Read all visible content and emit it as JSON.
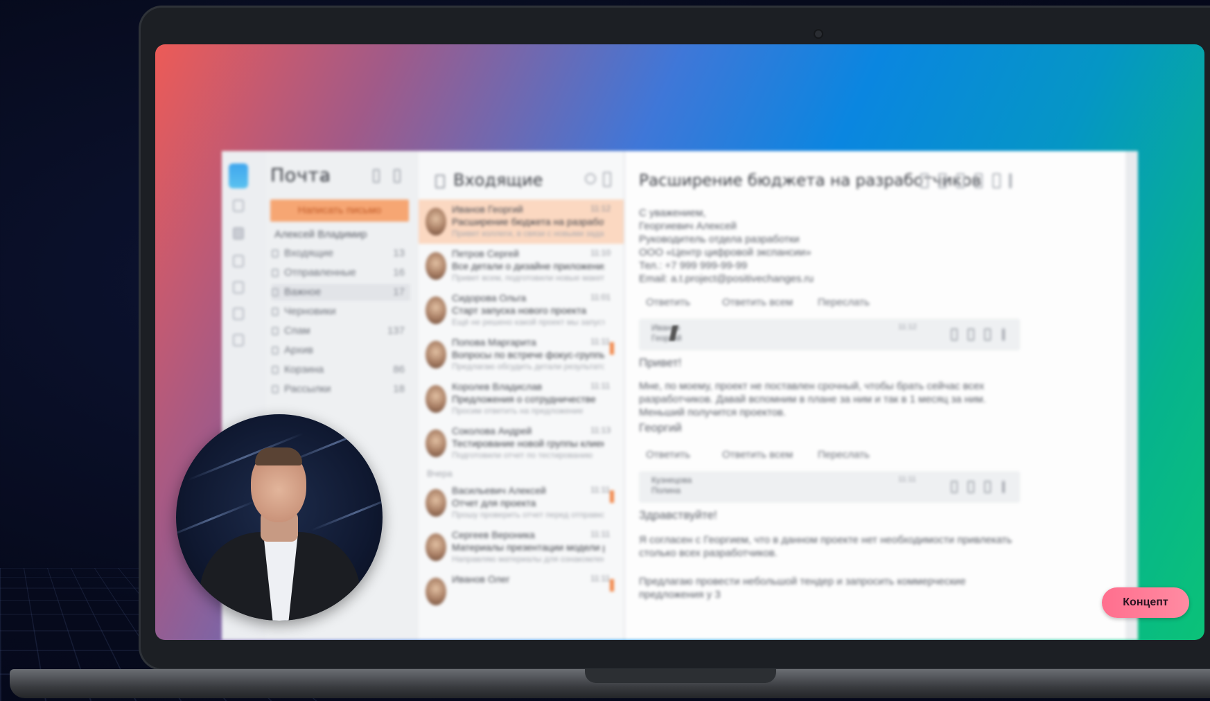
{
  "app": {
    "folders_title": "Почта",
    "write_button": "Написать письмо",
    "account": "Алексей Владимир",
    "folders": [
      {
        "label": "Входящие",
        "count": "13"
      },
      {
        "label": "Отправленные",
        "count": "16"
      },
      {
        "label": "Важное",
        "count": "17"
      },
      {
        "label": "Черновики",
        "count": ""
      },
      {
        "label": "Спам",
        "count": "137"
      },
      {
        "label": "Архив",
        "count": ""
      },
      {
        "label": "Корзина",
        "count": "86"
      },
      {
        "label": "Рассылки",
        "count": "18"
      }
    ]
  },
  "list": {
    "title": "Входящие",
    "separator": "Вчера",
    "messages": [
      {
        "from": "Иванов Георгий",
        "subject": "Расширение бюджета на разработчиков",
        "preview": "Привет коллеги, в связи с новыми задачами",
        "time": "11:12",
        "flag": true
      },
      {
        "from": "Петров Сергей",
        "subject": "Все детали о дизайне приложения",
        "preview": "Привет всем, подготовили новые макеты",
        "time": "11:10",
        "flag": false
      },
      {
        "from": "Сидорова Ольга",
        "subject": "Старт запуска нового проекта",
        "preview": "Ещё не решено какой проект мы запустим",
        "time": "11:01",
        "flag": false
      },
      {
        "from": "Попова Маргарита",
        "subject": "Вопросы по встрече фокус-группы",
        "preview": "Предлагаю обсудить детали результатов",
        "time": "11:11",
        "flag": true
      },
      {
        "from": "Королев Владислав",
        "subject": "Предложения о сотрудничестве",
        "preview": "Просим ответить на предложение",
        "time": "11:11",
        "flag": false
      },
      {
        "from": "Соколова Андрей",
        "subject": "Тестирование новой группы клиентов",
        "preview": "Подготовили отчет по тестированию",
        "time": "11:13",
        "flag": false
      },
      {
        "from": "Васильевич Алексей",
        "subject": "Отчет для проекта",
        "preview": "Прошу проверить отчет перед отправкой",
        "time": "11:11",
        "flag": true
      },
      {
        "from": "Сергеев Вероника",
        "subject": "Материалы презентации модели развития",
        "preview": "Направляю материалы для ознакомления",
        "time": "11:11",
        "flag": false
      },
      {
        "from": "Иванов Олег",
        "subject": "",
        "preview": "",
        "time": "11:11",
        "flag": true
      }
    ]
  },
  "reader": {
    "title": "Расширение бюджета на разработчиков",
    "signature_lines": [
      "С уважением,",
      "Георгиевич Алексей",
      "Руководитель отдела разработки",
      "ООО «Центр цифровой экспансии»",
      "Тел.: +7 999 999-99-99",
      "Email: a.t.project@positivechanges.ru"
    ],
    "actions": {
      "reply": "Ответить",
      "reply_all": "Ответить всем",
      "forward": "Переслать"
    },
    "quote1": {
      "name_line1": "Иванов",
      "name_line2": "Георгий",
      "time": "11:12"
    },
    "greeting": "Привет!",
    "body1": "Мне, по моему, проект не поставлен срочный, чтобы брать сейчас всех разработчиков. Давай вспомним в плане за ним и так в 1 месяц за ним. Меньший получится проектов.",
    "sign1": "Георгий",
    "quote2": {
      "name_line1": "Кузнецова",
      "name_line2": "Полина",
      "time": "11:11"
    },
    "greeting2": "Здравствуйте!",
    "body2": "Я согласен с Георгием, что в данном проекте нет необходимости привлекать столько всех разработчиков.",
    "body3": "Предлагаю провести небольшой тендер и запросить коммерческие предложения у 3"
  },
  "concept_button": "Концепт"
}
